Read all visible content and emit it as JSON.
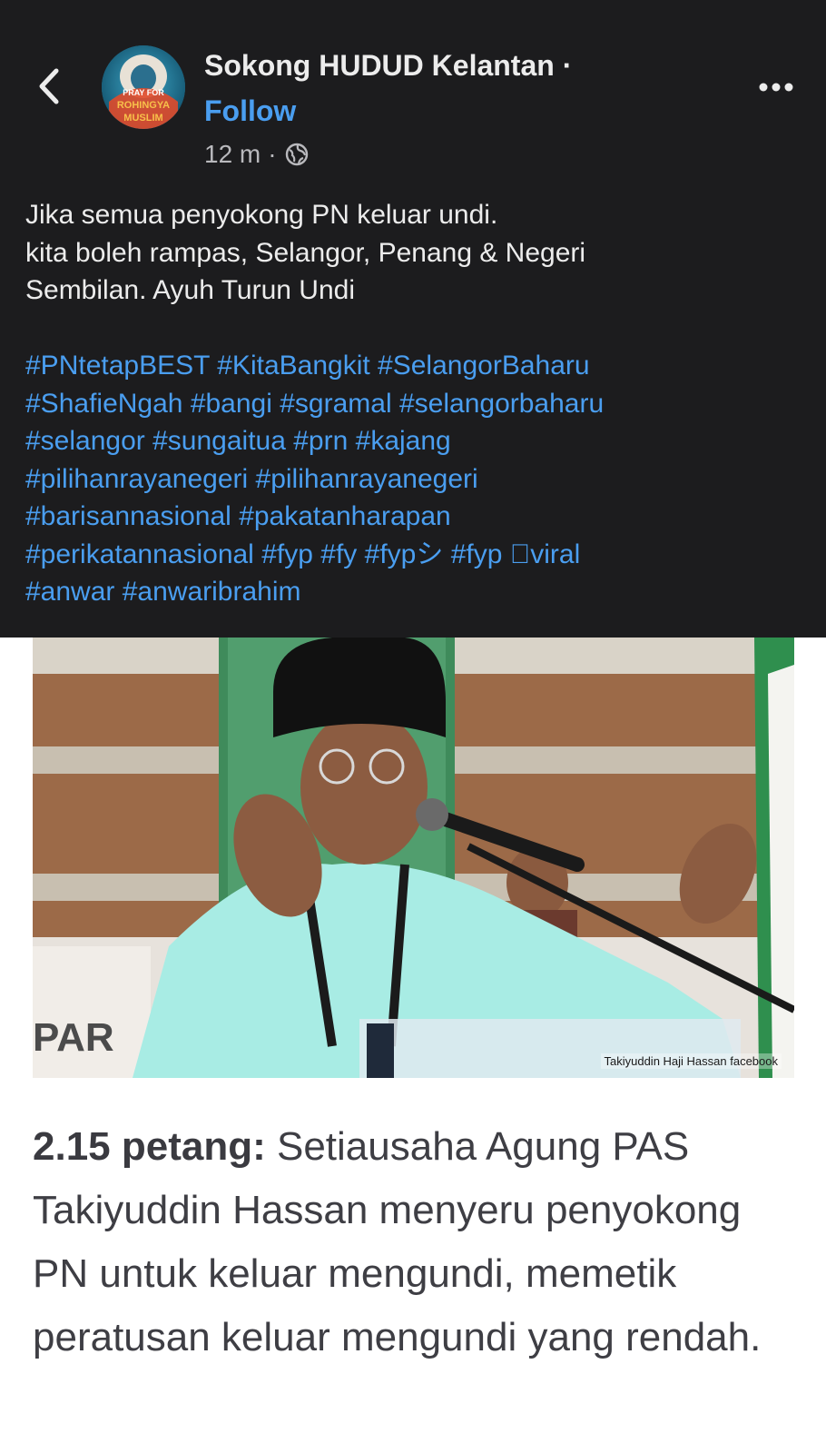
{
  "header": {
    "page_name": "Sokong HUDUD Kelantan ·",
    "follow_label": "Follow",
    "time": "12 m",
    "separator": "·",
    "privacy_icon": "globe-icon",
    "back_icon": "chevron-left-icon",
    "more_icon": "more-horizontal-icon",
    "avatar_text": [
      "PRAY FOR",
      "ROHINGYA",
      "MUSLIM"
    ]
  },
  "post": {
    "caption_lines": [
      "Jika semua penyokong PN keluar undi.",
      "kita boleh rampas, Selangor, Penang & Negeri",
      "Sembilan. Ayuh Turun Undi"
    ],
    "hashtag_lines": [
      [
        "#PNtetapBEST",
        "#KitaBangkit",
        "#SelangorBaharu"
      ],
      [
        "#ShafieNgah",
        "#bangi",
        "#sgramal",
        "#selangorbaharu"
      ],
      [
        "#selangor",
        "#sungaitua",
        "#prn",
        "#kajang"
      ],
      [
        "#pilihanrayanegeri",
        "#pilihanrayanegeri"
      ],
      [
        "#barisannasional",
        "#pakatanharapan"
      ],
      [
        "#perikatannasional",
        "#fyp",
        "#fy",
        "#fypシ",
        "#fyp ゚viral"
      ],
      [
        "#anwar",
        "#anwaribrahim"
      ]
    ]
  },
  "photo": {
    "credit": "Takiyuddin Haji Hassan facebook",
    "banner_text": "PAR"
  },
  "article": {
    "time_label": "2.15 petang:",
    "body": "Setiausaha Agung PAS Takiyuddin Hassan menyeru penyokong PN untuk keluar mengundi, memetik peratusan keluar mengundi yang rendah."
  },
  "colors": {
    "header_bg": "#1c1c1e",
    "link_blue": "#4a9ef0",
    "text_light": "#ececec",
    "article_text": "#3e3e44"
  }
}
